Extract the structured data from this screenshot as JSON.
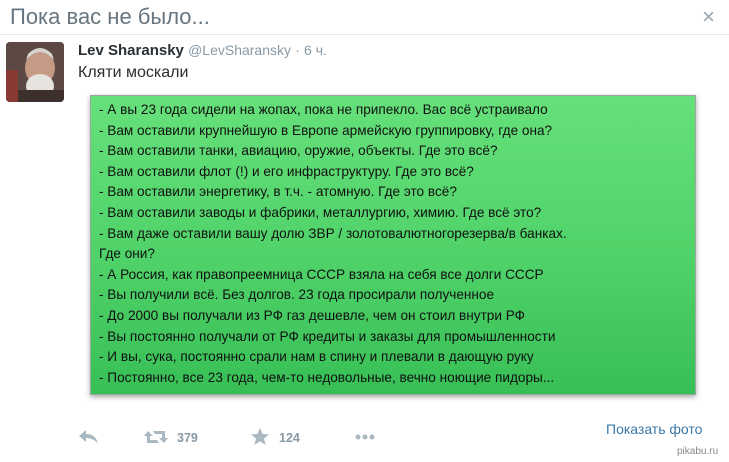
{
  "window": {
    "title": "Пока вас не было...",
    "close_label": "×"
  },
  "tweet": {
    "author_name": "Lev Sharansky",
    "handle": "@LevSharansky",
    "separator": "·",
    "time": "6 ч.",
    "text": "Кляти москали",
    "photo_lines": [
      "- А вы 23 года сидели на жопах, пока не припекло. Вас всё устраивало",
      "- Вам оставили крупнейшую в Европе армейскую группировку, где она?",
      "- Вам оставили танки, авиацию, оружие, объекты. Где это всё?",
      "- Вам оставили флот (!) и его инфраструктуру. Где это всё?",
      "- Вам оставили энергетику, в т.ч. - атомную. Где это всё?",
      "- Вам оставили заводы и фабрики, металлургию, химию. Где всё это?",
      "- Вам даже оставили вашу долю ЗВР / золотовалютногорезерва/в банках.",
      "Где они?",
      "- А Россия, как правопреемница СССР взяла на себя все долги СССР",
      "- Вы получили всё. Без долгов. 23 года просирали полученное",
      "- До 2000 вы получали из РФ газ дешевле, чем он стоил внутри РФ",
      "- Вы постоянно получали от РФ кредиты и заказы для промышленности",
      "- И вы, сука, постоянно срали нам в спину и плевали в дающую руку",
      "- Постоянно, все 23 года, чем-то недовольные, вечно ноющие пидоры..."
    ],
    "show_photo_label": "Показать фото",
    "retweet_count": "379",
    "favorite_count": "124"
  },
  "icons": {
    "reply": "reply-icon",
    "retweet": "retweet-icon",
    "favorite": "star-icon",
    "more": "more-icon",
    "close": "close-icon"
  },
  "colors": {
    "link": "#3b78a8",
    "photo_green": "#4fd269",
    "muted": "#8899a6"
  },
  "watermark": "pikabu.ru"
}
